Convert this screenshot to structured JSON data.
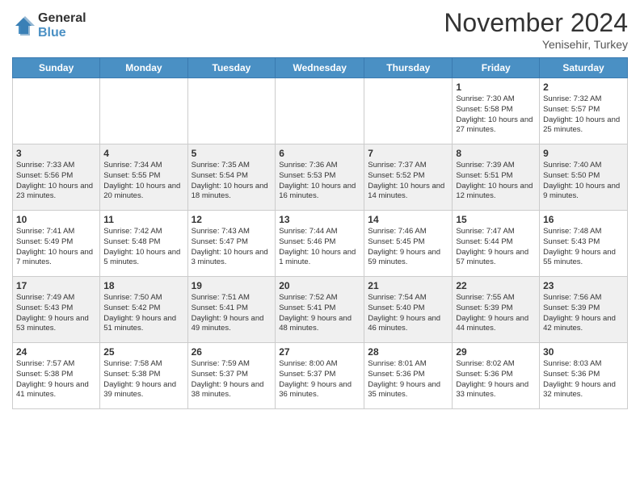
{
  "logo": {
    "general": "General",
    "blue": "Blue"
  },
  "header": {
    "month": "November 2024",
    "location": "Yenisehir, Turkey"
  },
  "weekdays": [
    "Sunday",
    "Monday",
    "Tuesday",
    "Wednesday",
    "Thursday",
    "Friday",
    "Saturday"
  ],
  "weeks": [
    [
      {
        "day": "",
        "info": ""
      },
      {
        "day": "",
        "info": ""
      },
      {
        "day": "",
        "info": ""
      },
      {
        "day": "",
        "info": ""
      },
      {
        "day": "",
        "info": ""
      },
      {
        "day": "1",
        "info": "Sunrise: 7:30 AM\nSunset: 5:58 PM\nDaylight: 10 hours and 27 minutes."
      },
      {
        "day": "2",
        "info": "Sunrise: 7:32 AM\nSunset: 5:57 PM\nDaylight: 10 hours and 25 minutes."
      }
    ],
    [
      {
        "day": "3",
        "info": "Sunrise: 7:33 AM\nSunset: 5:56 PM\nDaylight: 10 hours and 23 minutes."
      },
      {
        "day": "4",
        "info": "Sunrise: 7:34 AM\nSunset: 5:55 PM\nDaylight: 10 hours and 20 minutes."
      },
      {
        "day": "5",
        "info": "Sunrise: 7:35 AM\nSunset: 5:54 PM\nDaylight: 10 hours and 18 minutes."
      },
      {
        "day": "6",
        "info": "Sunrise: 7:36 AM\nSunset: 5:53 PM\nDaylight: 10 hours and 16 minutes."
      },
      {
        "day": "7",
        "info": "Sunrise: 7:37 AM\nSunset: 5:52 PM\nDaylight: 10 hours and 14 minutes."
      },
      {
        "day": "8",
        "info": "Sunrise: 7:39 AM\nSunset: 5:51 PM\nDaylight: 10 hours and 12 minutes."
      },
      {
        "day": "9",
        "info": "Sunrise: 7:40 AM\nSunset: 5:50 PM\nDaylight: 10 hours and 9 minutes."
      }
    ],
    [
      {
        "day": "10",
        "info": "Sunrise: 7:41 AM\nSunset: 5:49 PM\nDaylight: 10 hours and 7 minutes."
      },
      {
        "day": "11",
        "info": "Sunrise: 7:42 AM\nSunset: 5:48 PM\nDaylight: 10 hours and 5 minutes."
      },
      {
        "day": "12",
        "info": "Sunrise: 7:43 AM\nSunset: 5:47 PM\nDaylight: 10 hours and 3 minutes."
      },
      {
        "day": "13",
        "info": "Sunrise: 7:44 AM\nSunset: 5:46 PM\nDaylight: 10 hours and 1 minute."
      },
      {
        "day": "14",
        "info": "Sunrise: 7:46 AM\nSunset: 5:45 PM\nDaylight: 9 hours and 59 minutes."
      },
      {
        "day": "15",
        "info": "Sunrise: 7:47 AM\nSunset: 5:44 PM\nDaylight: 9 hours and 57 minutes."
      },
      {
        "day": "16",
        "info": "Sunrise: 7:48 AM\nSunset: 5:43 PM\nDaylight: 9 hours and 55 minutes."
      }
    ],
    [
      {
        "day": "17",
        "info": "Sunrise: 7:49 AM\nSunset: 5:43 PM\nDaylight: 9 hours and 53 minutes."
      },
      {
        "day": "18",
        "info": "Sunrise: 7:50 AM\nSunset: 5:42 PM\nDaylight: 9 hours and 51 minutes."
      },
      {
        "day": "19",
        "info": "Sunrise: 7:51 AM\nSunset: 5:41 PM\nDaylight: 9 hours and 49 minutes."
      },
      {
        "day": "20",
        "info": "Sunrise: 7:52 AM\nSunset: 5:41 PM\nDaylight: 9 hours and 48 minutes."
      },
      {
        "day": "21",
        "info": "Sunrise: 7:54 AM\nSunset: 5:40 PM\nDaylight: 9 hours and 46 minutes."
      },
      {
        "day": "22",
        "info": "Sunrise: 7:55 AM\nSunset: 5:39 PM\nDaylight: 9 hours and 44 minutes."
      },
      {
        "day": "23",
        "info": "Sunrise: 7:56 AM\nSunset: 5:39 PM\nDaylight: 9 hours and 42 minutes."
      }
    ],
    [
      {
        "day": "24",
        "info": "Sunrise: 7:57 AM\nSunset: 5:38 PM\nDaylight: 9 hours and 41 minutes."
      },
      {
        "day": "25",
        "info": "Sunrise: 7:58 AM\nSunset: 5:38 PM\nDaylight: 9 hours and 39 minutes."
      },
      {
        "day": "26",
        "info": "Sunrise: 7:59 AM\nSunset: 5:37 PM\nDaylight: 9 hours and 38 minutes."
      },
      {
        "day": "27",
        "info": "Sunrise: 8:00 AM\nSunset: 5:37 PM\nDaylight: 9 hours and 36 minutes."
      },
      {
        "day": "28",
        "info": "Sunrise: 8:01 AM\nSunset: 5:36 PM\nDaylight: 9 hours and 35 minutes."
      },
      {
        "day": "29",
        "info": "Sunrise: 8:02 AM\nSunset: 5:36 PM\nDaylight: 9 hours and 33 minutes."
      },
      {
        "day": "30",
        "info": "Sunrise: 8:03 AM\nSunset: 5:36 PM\nDaylight: 9 hours and 32 minutes."
      }
    ]
  ]
}
